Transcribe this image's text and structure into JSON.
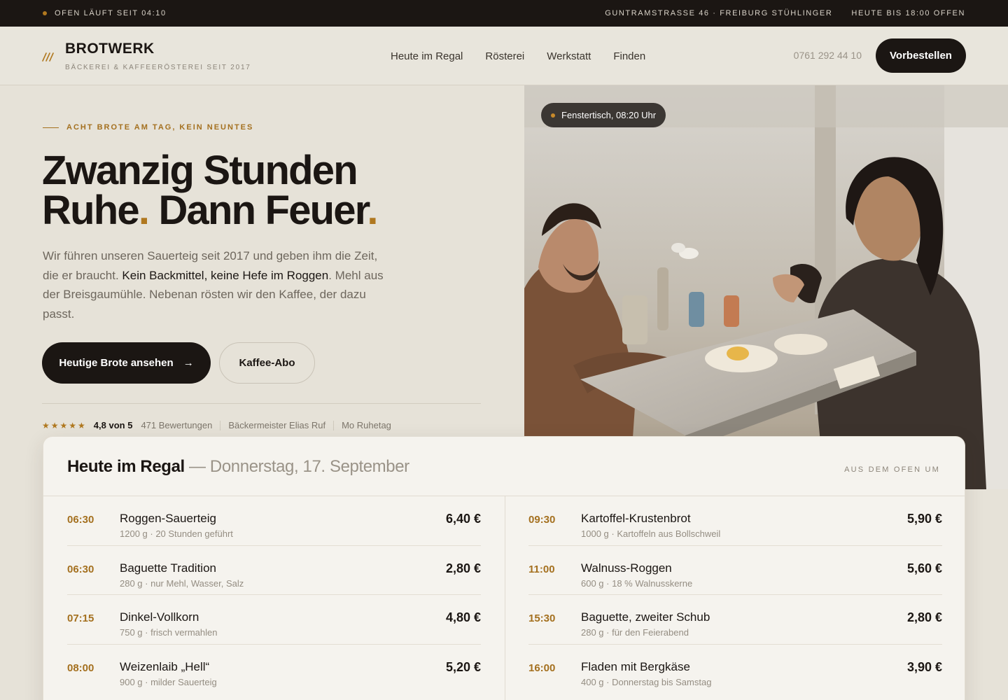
{
  "topbar": {
    "oven_status": "OFEN LÄUFT SEIT 04:10",
    "address": "GUNTRAMSTRASSE 46 · FREIBURG STÜHLINGER",
    "hours": "HEUTE BIS 18:00 OFFEN"
  },
  "header": {
    "brand": "BROTWERK",
    "tagline": "BÄCKEREI & KAFFEERÖSTEREI SEIT 2017",
    "nav": [
      "Heute im Regal",
      "Rösterei",
      "Werkstatt",
      "Finden"
    ],
    "phone": "0761 292 44 10",
    "cta": "Vorbestellen"
  },
  "hero": {
    "eyebrow": "ACHT BROTE AM TAG, KEIN NEUNTES",
    "headline_line1": "Zwanzig Stunden",
    "headline_line2a": "Ruhe",
    "headline_dot": ".",
    "headline_line2b": " Dann Feuer",
    "lead_part1": "Wir führen unseren Sauerteig seit 2017 und geben ihm die Zeit, die er braucht. ",
    "lead_bold": "Kein Backmittel, keine Hefe im Roggen",
    "lead_part2": ". Mehl aus der Breisgaumühle. Nebenan rösten wir den Kaffee, der dazu passt.",
    "primary_button": "Heutige Brote ansehen",
    "primary_arrow": "→",
    "secondary_button": "Kaffee-Abo",
    "stars": "★★★★★",
    "rating": "4,8 von 5",
    "reviews": "471 Bewertungen",
    "master": "Bäckermeister Elias Ruf",
    "closed": "Mo Ruhetag",
    "photo_tag": "Fenstertisch, 08:20 Uhr"
  },
  "menu": {
    "title": "Heute im Regal",
    "date": " — Donnerstag, 17. September",
    "note": "AUS DEM OFEN UM",
    "left": [
      {
        "time": "06:30",
        "name": "Roggen-Sauerteig",
        "desc": "1200 g · 20 Stunden geführt",
        "price": "6,40 €"
      },
      {
        "time": "06:30",
        "name": "Baguette Tradition",
        "desc": "280 g · nur Mehl, Wasser, Salz",
        "price": "2,80 €"
      },
      {
        "time": "07:15",
        "name": "Dinkel-Vollkorn",
        "desc": "750 g · frisch vermahlen",
        "price": "4,80 €"
      },
      {
        "time": "08:00",
        "name": "Weizenlaib „Hell“",
        "desc": "900 g · milder Sauerteig",
        "price": "5,20 €"
      }
    ],
    "right": [
      {
        "time": "09:30",
        "name": "Kartoffel-Krustenbrot",
        "desc": "1000 g · Kartoffeln aus Bollschweil",
        "price": "5,90 €"
      },
      {
        "time": "11:00",
        "name": "Walnuss-Roggen",
        "desc": "600 g · 18 % Walnusskerne",
        "price": "5,60 €"
      },
      {
        "time": "15:30",
        "name": "Baguette, zweiter Schub",
        "desc": "280 g · für den Feierabend",
        "price": "2,80 €"
      },
      {
        "time": "16:00",
        "name": "Fladen mit Bergkäse",
        "desc": "400 g · Donnerstag bis Samstag",
        "price": "3,90 €"
      }
    ]
  }
}
